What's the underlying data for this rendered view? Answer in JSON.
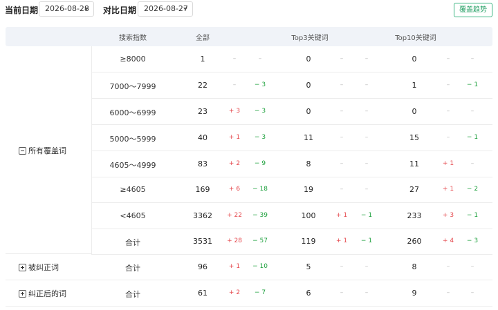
{
  "toolbar": {
    "current_date_label": "当前日期",
    "current_date": "2026-08-28",
    "compare_date_label": "对比日期",
    "compare_date": "2026-08-27",
    "trend_button": "覆盖趋势"
  },
  "table": {
    "headers": {
      "index": "搜索指数",
      "all": "全部",
      "top3": "Top3关键词",
      "top10": "Top10关键词"
    },
    "groups": [
      {
        "label": "所有覆盖词",
        "icon": "minus-square-icon"
      },
      {
        "label": "被纠正词",
        "icon": "plus-square-icon"
      },
      {
        "label": "纠正后的词",
        "icon": "plus-square-icon"
      }
    ],
    "rows": [
      {
        "range": "≥8000",
        "all": "1",
        "all_up": "–",
        "all_down": "–",
        "top3": "0",
        "top3_up": "–",
        "top3_down": "–",
        "top10": "0",
        "top10_up": "–",
        "top10_down": "–"
      },
      {
        "range": "7000～7999",
        "all": "22",
        "all_up": "–",
        "all_down": "− 3",
        "top3": "0",
        "top3_up": "–",
        "top3_down": "–",
        "top10": "1",
        "top10_up": "–",
        "top10_down": "− 1"
      },
      {
        "range": "6000～6999",
        "all": "23",
        "all_up": "+ 3",
        "all_down": "− 3",
        "top3": "0",
        "top3_up": "–",
        "top3_down": "–",
        "top10": "0",
        "top10_up": "–",
        "top10_down": "–"
      },
      {
        "range": "5000～5999",
        "all": "40",
        "all_up": "+ 1",
        "all_down": "− 3",
        "top3": "11",
        "top3_up": "–",
        "top3_down": "–",
        "top10": "15",
        "top10_up": "–",
        "top10_down": "− 1"
      },
      {
        "range": "4605～4999",
        "all": "83",
        "all_up": "+ 2",
        "all_down": "− 9",
        "top3": "8",
        "top3_up": "–",
        "top3_down": "–",
        "top10": "11",
        "top10_up": "+ 1",
        "top10_down": "–"
      },
      {
        "range": "≥4605",
        "all": "169",
        "all_up": "+ 6",
        "all_down": "− 18",
        "top3": "19",
        "top3_up": "–",
        "top3_down": "–",
        "top10": "27",
        "top10_up": "+ 1",
        "top10_down": "− 2"
      },
      {
        "range": "<4605",
        "all": "3362",
        "all_up": "+ 22",
        "all_down": "− 39",
        "top3": "100",
        "top3_up": "+ 1",
        "top3_down": "− 1",
        "top10": "233",
        "top10_up": "+ 3",
        "top10_down": "− 1"
      },
      {
        "range": "合计",
        "all": "3531",
        "all_up": "+ 28",
        "all_down": "− 57",
        "top3": "119",
        "top3_up": "+ 1",
        "top3_down": "− 1",
        "top10": "260",
        "top10_up": "+ 4",
        "top10_down": "− 3"
      },
      {
        "range": "合计",
        "all": "96",
        "all_up": "+ 1",
        "all_down": "− 10",
        "top3": "5",
        "top3_up": "–",
        "top3_down": "–",
        "top10": "8",
        "top10_up": "–",
        "top10_down": "–"
      },
      {
        "range": "合计",
        "all": "61",
        "all_up": "+ 2",
        "all_down": "− 7",
        "top3": "6",
        "top3_up": "–",
        "top3_down": "–",
        "top10": "9",
        "top10_up": "–",
        "top10_down": "–"
      }
    ]
  },
  "colors": {
    "increase": "#e5484d",
    "decrease": "#1a9f3a",
    "accent": "#1f9d61",
    "header_bg": "#f0f3f8"
  }
}
